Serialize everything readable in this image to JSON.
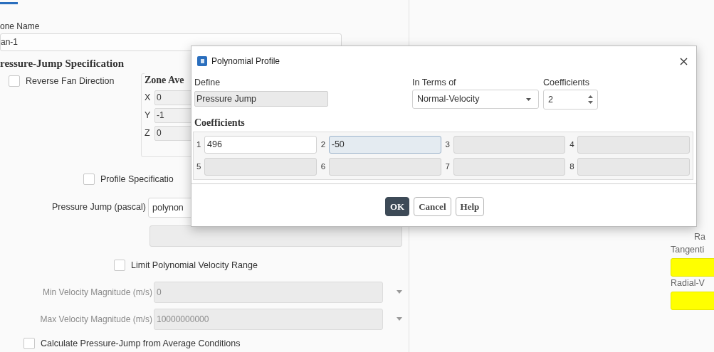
{
  "panel": {
    "zone_name_label": "one Name",
    "zone_name": "an-1",
    "section_title": "ressure-Jump Specification",
    "reverse_fan": {
      "label": "Reverse Fan Direction",
      "checked": false
    },
    "zone_average_title": "Zone Ave",
    "axis": [
      {
        "label": "X",
        "value": "0"
      },
      {
        "label": "Y",
        "value": "-1"
      },
      {
        "label": "Z",
        "value": "0"
      }
    ],
    "profile_spec": {
      "label": "Profile Specificatio",
      "checked": false
    },
    "pressure_jump": {
      "label": "Pressure Jump (pascal)",
      "value": "polynon"
    },
    "limit_range": {
      "label": "Limit Polynomial Velocity Range",
      "checked": false
    },
    "velocity_fields": [
      {
        "label": "Min Velocity Magnitude (m/s)",
        "value": "0",
        "disabled": true
      },
      {
        "label": "Max Velocity Magnitude (m/s)",
        "value": "10000000000",
        "disabled": true
      }
    ],
    "calc_average": {
      "label": "Calculate Pressure-Jump from Average Conditions",
      "checked": false
    }
  },
  "right_panel": {
    "label_1": "Ra",
    "fields": [
      {
        "label": "Tangenti"
      },
      {
        "label": "Radial-V"
      }
    ]
  },
  "dialog": {
    "title": "Polynomial Profile",
    "define": {
      "label": "Define",
      "value": "Pressure Jump"
    },
    "in_terms_of": {
      "label": "In Terms of",
      "value": "Normal-Velocity"
    },
    "coefficient_count": {
      "label": "Coefficients",
      "value": "2"
    },
    "coefficients_title": "Coefficients",
    "coefficients": [
      {
        "index": "1",
        "value": "496",
        "disabled": false,
        "focused": false
      },
      {
        "index": "2",
        "value": "-50",
        "disabled": false,
        "focused": true
      },
      {
        "index": "3",
        "disabled": true,
        "focused": false
      },
      {
        "index": "4",
        "disabled": true,
        "focused": false
      },
      {
        "index": "5",
        "disabled": true,
        "focused": false
      },
      {
        "index": "6",
        "disabled": true,
        "focused": false
      },
      {
        "index": "7",
        "disabled": true,
        "focused": false
      },
      {
        "index": "8",
        "disabled": true,
        "focused": false
      }
    ],
    "buttons": [
      {
        "label": "OK",
        "default": true
      },
      {
        "label": "Cancel",
        "default": false
      },
      {
        "label": "Help",
        "default": false
      }
    ]
  }
}
